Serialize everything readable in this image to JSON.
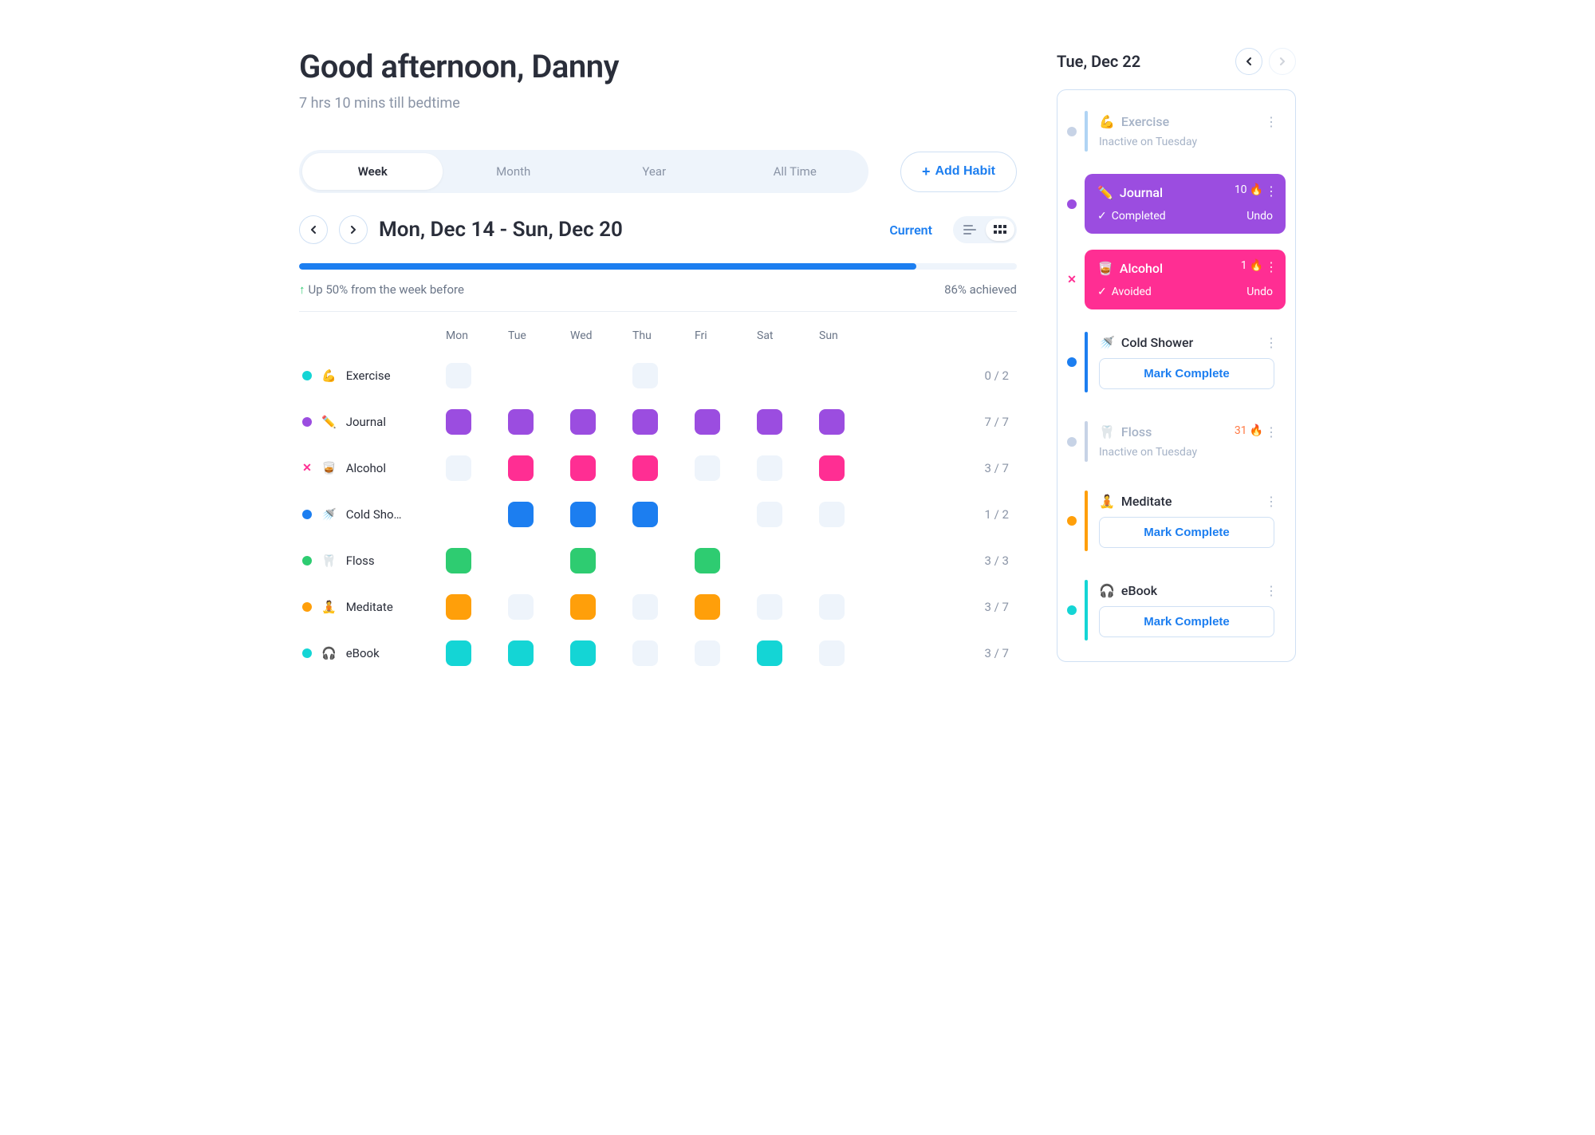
{
  "greeting": "Good afternoon, Danny",
  "subtitle": "7 hrs 10 mins till bedtime",
  "segments": [
    "Week",
    "Month",
    "Year",
    "All Time"
  ],
  "active_segment": "Week",
  "add_habit_label": "Add Habit",
  "range_label": "Mon, Dec 14 - Sun, Dec 20",
  "current_label": "Current",
  "progress_percent": 86,
  "delta_text": "Up 50% from the week before",
  "achieved_text": "86% achieved",
  "days": [
    "Mon",
    "Tue",
    "Wed",
    "Thu",
    "Fri",
    "Sat",
    "Sun"
  ],
  "habits": [
    {
      "id": "exercise",
      "emoji": "💪",
      "name": "Exercise",
      "dot": "c-cyan-dot",
      "type": "dot",
      "cells": [
        "empty",
        "",
        "",
        "empty",
        "",
        "",
        ""
      ],
      "done": 0,
      "goal": 2
    },
    {
      "id": "journal",
      "emoji": "✏️",
      "name": "Journal",
      "dot": "c-purple-dot",
      "type": "dot",
      "cells": [
        "c-purple",
        "c-purple",
        "c-purple",
        "c-purple",
        "c-purple",
        "c-purple",
        "c-purple"
      ],
      "done": 7,
      "goal": 7
    },
    {
      "id": "alcohol",
      "emoji": "🥃",
      "name": "Alcohol",
      "dot": "",
      "type": "x",
      "cells": [
        "empty",
        "c-pink",
        "c-pink",
        "c-pink",
        "empty",
        "empty",
        "c-pink"
      ],
      "done": 3,
      "goal": 7
    },
    {
      "id": "coldshower",
      "emoji": "🚿",
      "name": "Cold Sho…",
      "dot": "c-blue-dot",
      "type": "dot",
      "cells": [
        "",
        "c-blue",
        "c-blue",
        "c-blue",
        "",
        "empty",
        "empty"
      ],
      "done": 1,
      "goal": 2
    },
    {
      "id": "floss",
      "emoji": "🦷",
      "name": "Floss",
      "dot": "c-green-dot",
      "type": "dot",
      "cells": [
        "c-green",
        "",
        "c-green",
        "",
        "c-green",
        "",
        ""
      ],
      "done": 3,
      "goal": 3
    },
    {
      "id": "meditate",
      "emoji": "🧘",
      "name": "Meditate",
      "dot": "c-orange-dot",
      "type": "dot",
      "cells": [
        "c-orange",
        "empty",
        "c-orange",
        "empty",
        "c-orange",
        "empty",
        "empty"
      ],
      "done": 3,
      "goal": 7
    },
    {
      "id": "ebook",
      "emoji": "🎧",
      "name": "eBook",
      "dot": "c-teal-dot",
      "type": "dot",
      "cells": [
        "c-teal",
        "c-teal",
        "c-teal",
        "empty",
        "empty",
        "c-teal",
        "empty"
      ],
      "done": 3,
      "goal": 7
    }
  ],
  "side": {
    "date": "Tue, Dec 22",
    "undo": "Undo",
    "mark_complete": "Mark Complete",
    "cards": [
      {
        "id": "exercise",
        "emoji": "💪",
        "name": "Exercise",
        "bar": "#b0d4f4",
        "dot": "c-gray-dot",
        "inactive": true,
        "sub": "Inactive on Tuesday"
      },
      {
        "id": "journal",
        "emoji": "✏️",
        "name": "Journal",
        "fill": "#9b4de0",
        "dot": "c-purple-dot",
        "status": "Completed",
        "streak": 10
      },
      {
        "id": "alcohol",
        "emoji": "🥃",
        "name": "Alcohol",
        "fill": "#ff2e93",
        "dot_type": "x",
        "status": "Avoided",
        "streak": 1
      },
      {
        "id": "coldshower",
        "emoji": "🚿",
        "name": "Cold Shower",
        "bar": "#1c7ef0",
        "dot": "c-blue-dot",
        "action": "mark"
      },
      {
        "id": "floss",
        "emoji": "🦷",
        "name": "Floss",
        "bar": "#c7d3e6",
        "dot": "c-gray-dot",
        "inactive": true,
        "sub": "Inactive on Tuesday",
        "streak": 31,
        "streak_color": "#ff7a45"
      },
      {
        "id": "meditate",
        "emoji": "🧘",
        "name": "Meditate",
        "bar": "#ff9f0a",
        "dot": "c-orange-dot",
        "action": "mark"
      },
      {
        "id": "ebook",
        "emoji": "🎧",
        "name": "eBook",
        "bar": "#14d5d5",
        "dot": "c-teal-dot",
        "action": "mark"
      }
    ]
  }
}
